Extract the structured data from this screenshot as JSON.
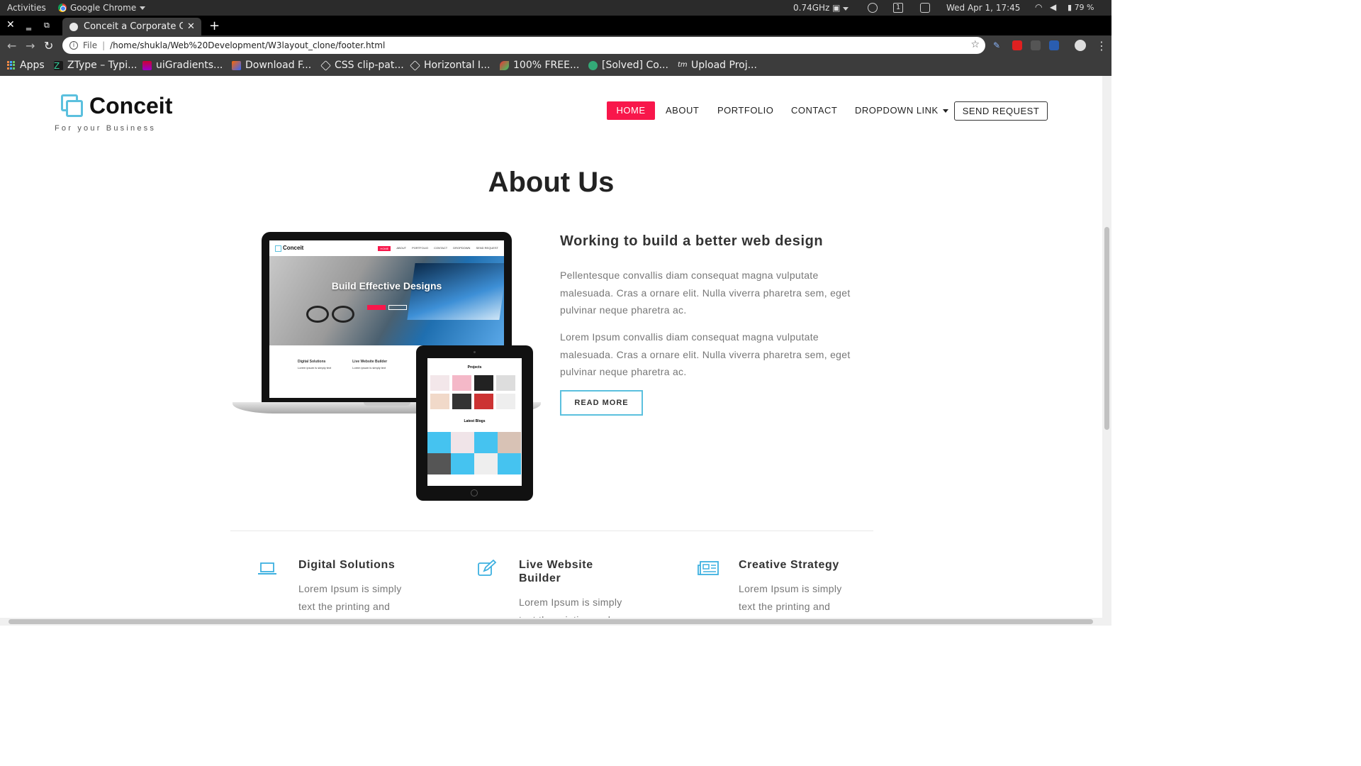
{
  "system_bar": {
    "activities": "Activities",
    "app_name": "Google Chrome",
    "cpu": "0.74GHz",
    "workspace": "1",
    "clock": "Wed Apr  1, 17:45",
    "battery": "79 %"
  },
  "browser": {
    "tab_title": "Conceit a Corporate C",
    "url_scheme_label": "File",
    "url": "/home/shukla/Web%20Development/W3layout_clone/footer.html",
    "bookmarks": [
      {
        "label": "Apps"
      },
      {
        "label": "ZType – Typi..."
      },
      {
        "label": "uiGradients..."
      },
      {
        "label": "Download F..."
      },
      {
        "label": "CSS clip-pat..."
      },
      {
        "label": "Horizontal I..."
      },
      {
        "label": "100% FREE..."
      },
      {
        "label": "[Solved] Co..."
      },
      {
        "label": "Upload Proj..."
      }
    ]
  },
  "site": {
    "brand": "Conceit",
    "tagline": "For your Business",
    "nav": {
      "home": "HOME",
      "about": "ABOUT",
      "portfolio": "PORTFOLIO",
      "contact": "CONTACT",
      "dropdown": "DROPDOWN LINK",
      "send_request": "SEND REQUEST"
    },
    "accent_color": "#f8174b",
    "secondary_color": "#5bc0de"
  },
  "about": {
    "title": "About Us",
    "subheading": "Working to build a better web design",
    "paragraph1": "Pellentesque convallis diam consequat magna vulputate malesuada. Cras a ornare elit. Nulla viverra pharetra sem, eget pulvinar neque pharetra ac.",
    "paragraph2": "Lorem Ipsum convallis diam consequat magna vulputate malesuada. Cras a ornare elit. Nulla viverra pharetra sem, eget pulvinar neque pharetra ac.",
    "read_more": "READ MORE",
    "mockup": {
      "hero_title": "Build Effective Designs",
      "brand": "Conceit",
      "nav": [
        "HOME",
        "ABOUT",
        "PORTFOLIO",
        "CONTACT",
        "DROPDOWN",
        "SEND REQUEST"
      ],
      "service1": "Digital Solutions",
      "service2": "Live Website Builder",
      "tablet_heading1": "Projects",
      "tablet_heading2": "Latest Blogs"
    }
  },
  "services": [
    {
      "title": "Digital Solutions",
      "text": "Lorem Ipsum is simply text the printing and",
      "icon": "laptop-icon"
    },
    {
      "title": "Live Website Builder",
      "text": "Lorem Ipsum is simply text the printing and",
      "icon": "edit-icon"
    },
    {
      "title": "Creative Strategy",
      "text": "Lorem Ipsum is simply text the printing and",
      "icon": "newspaper-icon"
    }
  ]
}
